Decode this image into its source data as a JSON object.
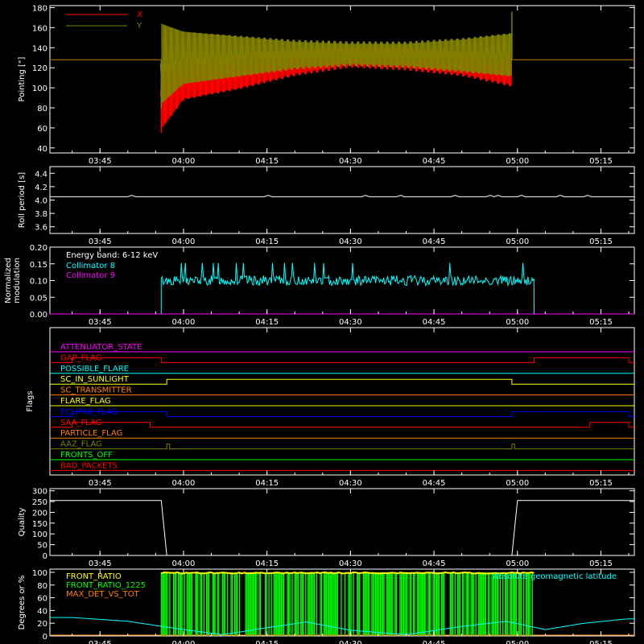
{
  "chart_data": [
    {
      "type": "line",
      "ylabel": "Pointing [\"]",
      "ylim": [
        35,
        182
      ],
      "yticks": [
        40,
        60,
        80,
        100,
        120,
        140,
        160,
        180
      ],
      "x_ticks": [
        "03:45",
        "04:00",
        "04:15",
        "04:30",
        "04:45",
        "05:00",
        "05:15"
      ],
      "legend_placement": "top-left",
      "series": [
        {
          "name": "X",
          "color": "#ff0000",
          "baseline": 128,
          "active_start": "03:56",
          "active_end": "04:59",
          "envelope_x": [
            "03:56",
            "04:00",
            "04:10",
            "04:20",
            "04:30",
            "04:40",
            "04:50",
            "04:59"
          ],
          "envelope_low": [
            55,
            85,
            96,
            110,
            119,
            116,
            110,
            99
          ],
          "envelope_high": [
            128,
            132,
            136,
            140,
            142,
            141,
            138,
            134
          ]
        },
        {
          "name": "Y",
          "color": "#808000",
          "baseline": 128,
          "active_start": "03:56",
          "active_end": "04:59",
          "envelope_x": [
            "03:56",
            "04:00",
            "04:10",
            "04:20",
            "04:30",
            "04:40",
            "04:50",
            "04:59"
          ],
          "envelope_low": [
            80,
            100,
            108,
            116,
            120,
            118,
            113,
            108
          ],
          "envelope_high": [
            168,
            160,
            155,
            150,
            148,
            148,
            152,
            158
          ]
        }
      ]
    },
    {
      "type": "line",
      "ylabel": "Roll period [s]",
      "ylim": [
        3.5,
        4.5
      ],
      "yticks": [
        3.6,
        3.8,
        4.0,
        4.2,
        4.4
      ],
      "x_ticks": [
        "03:45",
        "04:00",
        "04:15",
        "04:30",
        "04:45",
        "05:00",
        "05:15"
      ],
      "series": [
        {
          "name": "",
          "color": "#ffffff",
          "value": 4.05
        }
      ]
    },
    {
      "type": "line",
      "ylabel": "Normalized modulation",
      "ylim": [
        0,
        0.2
      ],
      "yticks": [
        0.0,
        0.05,
        0.1,
        0.15,
        0.2
      ],
      "ytick_labels": [
        "0.00",
        "0.05",
        "0.10",
        "0.15",
        "0.20"
      ],
      "x_ticks": [
        "03:45",
        "04:00",
        "04:15",
        "04:30",
        "04:45",
        "05:00",
        "05:15"
      ],
      "annotation": "Energy band: 6-12 keV",
      "series": [
        {
          "name": "Collimator 8",
          "color": "#00ffff",
          "active_start": "03:56",
          "active_end": "05:03",
          "mean": 0.1,
          "spread": 0.015
        },
        {
          "name": "Collimator 9",
          "color": "#ff00ff",
          "value": 0.0
        }
      ]
    },
    {
      "type": "line",
      "ylabel": "Flags",
      "x_ticks": [
        "03:45",
        "04:00",
        "04:15",
        "04:30",
        "04:45",
        "05:00",
        "05:15"
      ],
      "flags": [
        {
          "name": "ATTENUATOR_STATE",
          "color": "#ff00ff",
          "segments": []
        },
        {
          "name": "GAP_FLAG",
          "color": "#ff0000",
          "segments": [
            [
              "03:40",
              "03:56"
            ],
            [
              "05:03",
              "05:20"
            ]
          ]
        },
        {
          "name": "POSSIBLE_FLARE",
          "color": "#00ffff",
          "segments": []
        },
        {
          "name": "SC_IN_SUNLIGHT",
          "color": "#ffff00",
          "segments": [
            [
              "03:57",
              "04:59"
            ]
          ]
        },
        {
          "name": "SC_TRANSMITTER",
          "color": "#ff8000",
          "segments": []
        },
        {
          "name": "FLARE_FLAG",
          "color": "#ffff00",
          "segments": []
        },
        {
          "name": "ECLIPSE_FLAG",
          "color": "#0000ff",
          "segments": [
            [
              "03:40",
              "03:57"
            ],
            [
              "04:59",
              "05:20"
            ]
          ]
        },
        {
          "name": "SAA_FLAG",
          "color": "#ff0000",
          "segments": [
            [
              "03:40",
              "03:54"
            ],
            [
              "05:13",
              "05:20"
            ]
          ]
        },
        {
          "name": "PARTICLE_FLAG",
          "color": "#ff8000",
          "segments": []
        },
        {
          "name": "AAZ_FLAG",
          "color": "#808000",
          "segments": [
            [
              "03:57",
              "03:57.5"
            ],
            [
              "04:59",
              "04:59.5"
            ]
          ]
        },
        {
          "name": "FRONTS_OFF",
          "color": "#00ff00",
          "segments": []
        },
        {
          "name": "BAD_PACKETS",
          "color": "#ff0000",
          "segments": []
        }
      ]
    },
    {
      "type": "line",
      "ylabel": "Quality",
      "ylim": [
        0,
        310
      ],
      "yticks": [
        0,
        50,
        100,
        150,
        200,
        250,
        300
      ],
      "x_ticks": [
        "03:45",
        "04:00",
        "04:15",
        "04:30",
        "04:45",
        "05:00",
        "05:15"
      ],
      "series": [
        {
          "name": "",
          "color": "#ffffff",
          "high": 255,
          "low": 0,
          "low_start": "03:57",
          "low_end": "04:59"
        }
      ]
    },
    {
      "type": "line",
      "ylabel": "Degrees or %",
      "ylim": [
        0,
        105
      ],
      "yticks": [
        0,
        20,
        40,
        60,
        80,
        100
      ],
      "x_ticks": [
        "03:45",
        "04:00",
        "04:15",
        "04:30",
        "04:45",
        "05:00",
        "05:15"
      ],
      "series": [
        {
          "name": "FRONT_RATIO",
          "color": "#ffff00",
          "active_start": "03:56",
          "active_end": "05:03",
          "value": 100
        },
        {
          "name": "FRONT_RATIO_1225",
          "color": "#00ff00",
          "active_start": "03:56",
          "active_end": "05:03",
          "value": 100
        },
        {
          "name": "MAX_DET_VS_TOT",
          "color": "#ff8000",
          "value": 0
        },
        {
          "name": "Absolute geomagnetic latitude",
          "color": "#00ffff",
          "x": [
            "03:40",
            "03:50",
            "04:00",
            "04:07",
            "04:15",
            "04:22",
            "04:30",
            "04:40",
            "04:50",
            "04:58",
            "05:05",
            "05:12",
            "05:20"
          ],
          "y": [
            29,
            23,
            10,
            2,
            13,
            22,
            9,
            2,
            15,
            23,
            10,
            20,
            27
          ]
        }
      ]
    }
  ]
}
